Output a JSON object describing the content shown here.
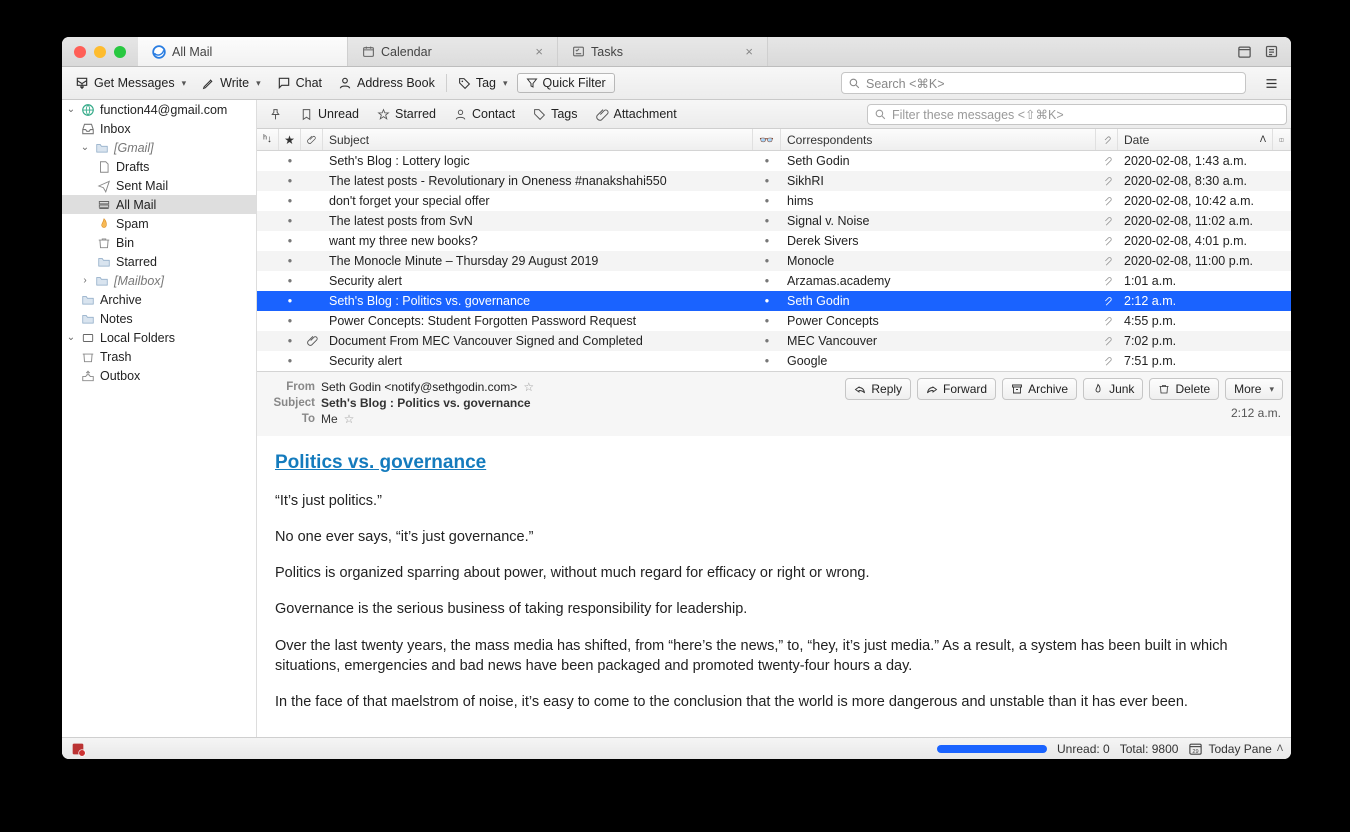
{
  "tabs": {
    "mail": "All Mail",
    "calendar": "Calendar",
    "tasks": "Tasks"
  },
  "toolbar": {
    "get_messages": "Get Messages",
    "write": "Write",
    "chat": "Chat",
    "address_book": "Address Book",
    "tag": "Tag",
    "quick_filter": "Quick Filter",
    "search_placeholder": "Search <⌘K>"
  },
  "sidebar": {
    "account": "function44@gmail.com",
    "inbox": "Inbox",
    "gmail": "[Gmail]",
    "drafts": "Drafts",
    "sent": "Sent Mail",
    "allmail": "All Mail",
    "spam": "Spam",
    "bin": "Bin",
    "starred": "Starred",
    "mailbox": "[Mailbox]",
    "archive": "Archive",
    "notes": "Notes",
    "local": "Local Folders",
    "trash": "Trash",
    "outbox": "Outbox"
  },
  "filterbar": {
    "unread": "Unread",
    "starred": "Starred",
    "contact": "Contact",
    "tags": "Tags",
    "attachment": "Attachment",
    "placeholder": "Filter these messages <⇧⌘K>"
  },
  "columns": {
    "subject": "Subject",
    "correspondents": "Correspondents",
    "date": "Date"
  },
  "messages": [
    {
      "subject": "Seth's Blog : Lottery logic",
      "from": "Seth Godin",
      "date": "2020-02-08, 1:43 a.m.",
      "attach": false,
      "sel": false
    },
    {
      "subject": "The latest posts - Revolutionary in Oneness #nanakshahi550",
      "from": "SikhRI",
      "date": "2020-02-08, 8:30 a.m.",
      "attach": false,
      "sel": false
    },
    {
      "subject": "don't forget your special offer",
      "from": "hims",
      "date": "2020-02-08, 10:42 a.m.",
      "attach": false,
      "sel": false
    },
    {
      "subject": "The latest posts from SvN",
      "from": "Signal v. Noise",
      "date": "2020-02-08, 11:02 a.m.",
      "attach": false,
      "sel": false
    },
    {
      "subject": "want my three new books?",
      "from": "Derek Sivers",
      "date": "2020-02-08, 4:01 p.m.",
      "attach": false,
      "sel": false
    },
    {
      "subject": "The Monocle Minute – Thursday 29 August 2019",
      "from": "Monocle",
      "date": "2020-02-08, 11:00 p.m.",
      "attach": false,
      "sel": false
    },
    {
      "subject": "Security alert",
      "from": "Arzamas.academy",
      "date": "1:01 a.m.",
      "attach": false,
      "sel": false
    },
    {
      "subject": "Seth's Blog : Politics vs. governance",
      "from": "Seth Godin",
      "date": "2:12 a.m.",
      "attach": false,
      "sel": true
    },
    {
      "subject": "Power Concepts: Student Forgotten Password Request",
      "from": "Power Concepts",
      "date": "4:55 p.m.",
      "attach": false,
      "sel": false
    },
    {
      "subject": "Document From MEC Vancouver Signed and Completed",
      "from": "MEC Vancouver",
      "date": "7:02 p.m.",
      "attach": true,
      "sel": false
    },
    {
      "subject": "Security alert",
      "from": "Google",
      "date": "7:51 p.m.",
      "attach": false,
      "sel": false
    }
  ],
  "preview": {
    "from_label": "From",
    "from_value": "Seth Godin <notify@sethgodin.com>",
    "subject_label": "Subject",
    "subject_value": "Seth's Blog : Politics vs. governance",
    "to_label": "To",
    "to_value": "Me",
    "time": "2:12 a.m.",
    "buttons": {
      "reply": "Reply",
      "forward": "Forward",
      "archive": "Archive",
      "junk": "Junk",
      "delete": "Delete",
      "more": "More"
    }
  },
  "body": {
    "title": "Politics vs. governance",
    "p1": "“It’s just politics.”",
    "p2": "No one ever says, “it’s just governance.”",
    "p3": "Politics is organized sparring about power, without much regard for efficacy or right or wrong.",
    "p4": "Governance is the serious business of taking responsibility for leadership.",
    "p5": "Over the last twenty years, the mass media has shifted, from “here’s the news,” to, “hey, it’s just media.” As a result, a system has been built in which situations, emergencies and bad news have been packaged and promoted twenty-four hours a day.",
    "p6": "In the face of that maelstrom of noise, it’s easy to come to the conclusion that the world is more dangerous and unstable than it has ever been."
  },
  "status": {
    "unread": "Unread: 0",
    "total": "Total: 9800",
    "today": "Today Pane"
  }
}
